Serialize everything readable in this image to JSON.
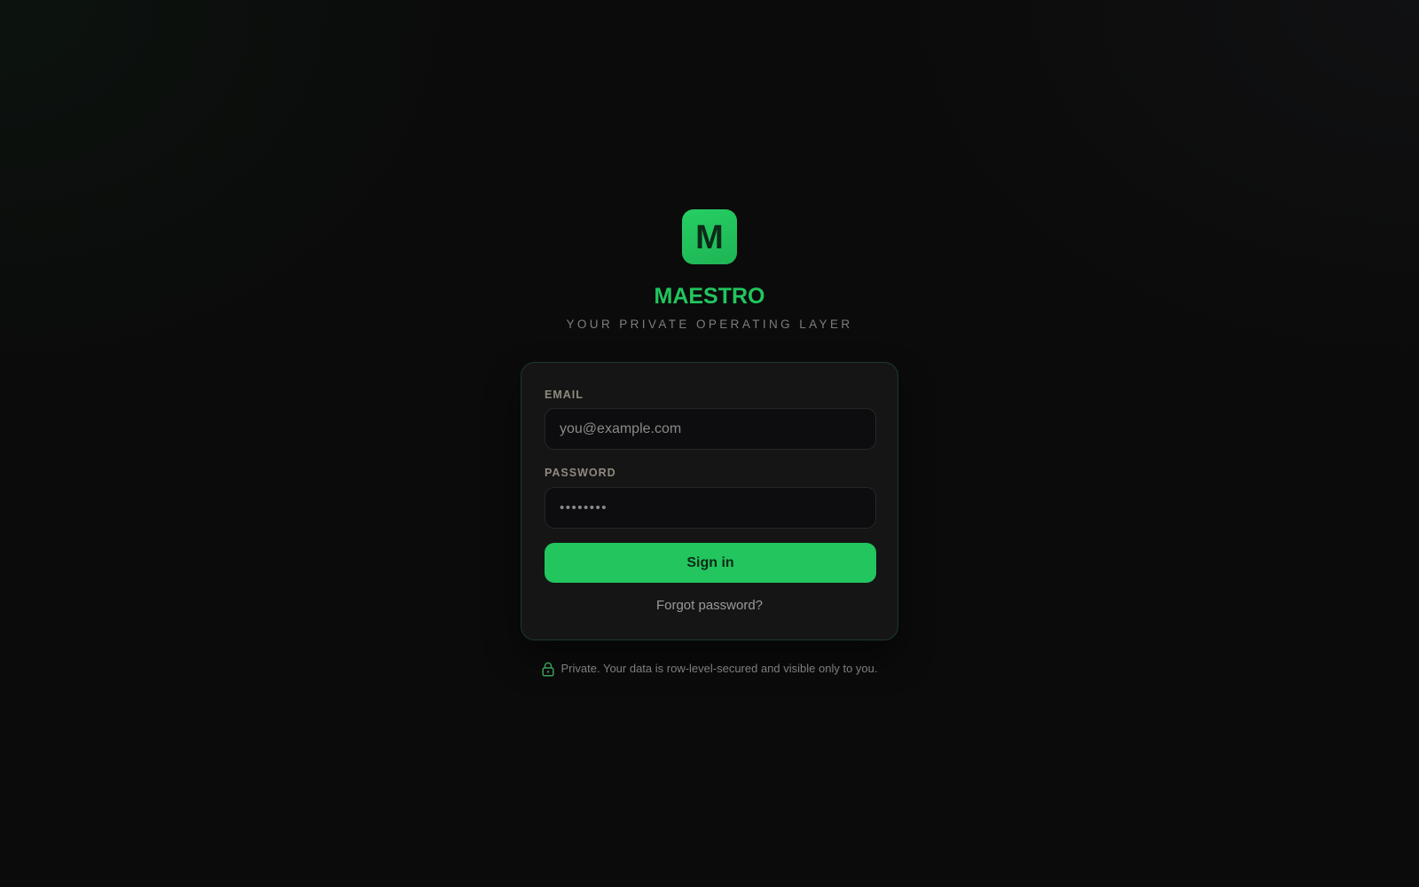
{
  "brand": {
    "logo_letter": "M",
    "name": "MAESTRO",
    "tagline": "YOUR PRIVATE OPERATING LAYER",
    "accent_color": "#22c55e"
  },
  "login": {
    "email": {
      "label": "EMAIL",
      "placeholder": "you@example.com",
      "value": ""
    },
    "password": {
      "label": "PASSWORD",
      "placeholder": "••••••••",
      "value": ""
    },
    "submit_label": "Sign in",
    "forgot_label": "Forgot password?"
  },
  "footer": {
    "icon": "lock-icon",
    "privacy_note": "Private. Your data is row-level-secured and visible only to you."
  }
}
